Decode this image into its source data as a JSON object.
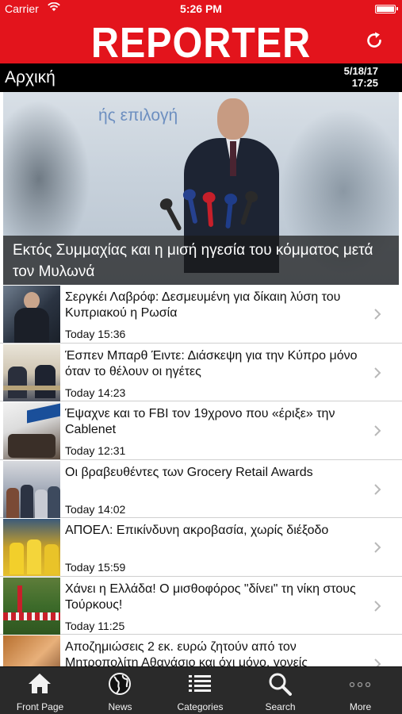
{
  "status_bar": {
    "carrier": "Carrier",
    "time": "5:26 PM"
  },
  "header": {
    "logo": "REPORTER",
    "brand_color": "#e3141c"
  },
  "section": {
    "title": "Αρχική",
    "date": "5/18/17",
    "time": "17:25"
  },
  "hero": {
    "background_text": "ής επιλογή",
    "caption": "Εκτός Συμμαχίας και η μισή ηγεσία του κόμματος μετά τον Μυλωνά"
  },
  "articles": [
    {
      "title": "Σεργκέι Λαβρόφ: Δεσμευμένη για δίκαιη λύση του Κυπριακού η Ρωσία",
      "time": "Today 15:36"
    },
    {
      "title": "Έσπεν Μπαρθ Έιντε: Διάσκεψη για την Κύπρο μόνο όταν το θέλουν οι ηγέτες",
      "time": "Today 14:23"
    },
    {
      "title": "Έψαχνε και το FBI τον 19χρονο που «έριξε» την Cablenet",
      "time": "Today 12:31"
    },
    {
      "title": "Οι βραβευθέντες των Grocery Retail Awards",
      "time": "Today 14:02"
    },
    {
      "title": "ΑΠΟΕΛ: Επικίνδυνη ακροβασία, χωρίς διέξοδο",
      "time": "Today 15:59"
    },
    {
      "title": "Χάνει η Ελλάδα! Ο μισθοφόρος \"δίνει\" τη νίκη στους Τούρκους!",
      "time": "Today 11:25"
    },
    {
      "title": "Αποζημιώσεις 2 εκ. ευρώ ζητούν από τον Μητροπολίτη Αθανάσιο και όχι μόνο, γονείς",
      "time": ""
    }
  ],
  "tabs": [
    {
      "label": "Front Page",
      "icon": "home-icon"
    },
    {
      "label": "News",
      "icon": "globe-icon"
    },
    {
      "label": "Categories",
      "icon": "list-icon"
    },
    {
      "label": "Search",
      "icon": "search-icon"
    },
    {
      "label": "More",
      "icon": "more-icon"
    }
  ]
}
